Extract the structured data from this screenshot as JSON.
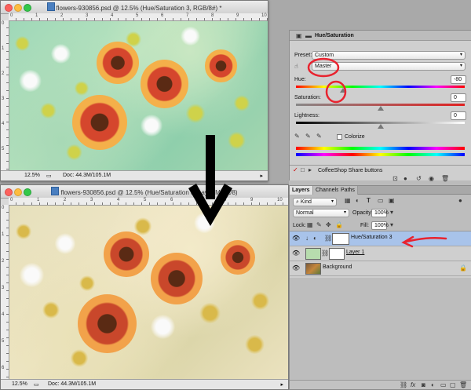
{
  "top_window": {
    "title": "flowers-930856.psd @ 12.5% (Hue/Saturation 3, RGB/8#) *",
    "zoom": "12.5%",
    "doc": "Doc: 44.3M/105.1M"
  },
  "bottom_window": {
    "title": "flowers-930856.psd @ 12.5% (Hue/Saturation 3, Layer Mask/8)",
    "zoom": "12.5%",
    "doc": "Doc: 44.3M/105.1M"
  },
  "ruler_numbers": [
    "0",
    "1",
    "2",
    "3",
    "4",
    "5",
    "6",
    "7",
    "8",
    "9",
    "10"
  ],
  "properties": {
    "title": "Hue/Saturation",
    "preset_label": "Preset:",
    "preset_value": "Custom",
    "channel_value": "Master",
    "hue_label": "Hue:",
    "hue_value": "-80",
    "hue_level": 0.28,
    "saturation_label": "Saturation:",
    "saturation_value": "0",
    "saturation_level": 0.5,
    "lightness_label": "Lightness:",
    "lightness_value": "0",
    "lightness_level": 0.5,
    "colorize_label": "Colorize",
    "coffeeshop_label": "CoffeeShop Share buttons"
  },
  "layers": {
    "tabs": [
      "Layers",
      "Channels",
      "Paths"
    ],
    "kind_label": "Kind",
    "blend_mode": "Normal",
    "opacity_label": "Opacity:",
    "opacity_value": "100%",
    "lock_label": "Lock:",
    "fill_label": "Fill:",
    "fill_value": "100%",
    "items": [
      {
        "name": "Hue/Saturation 3"
      },
      {
        "name": "Layer 1"
      },
      {
        "name": "Background"
      }
    ]
  },
  "colors": {
    "annotation_red": "#e8232f",
    "selection_blue": "#a8c3ea"
  }
}
